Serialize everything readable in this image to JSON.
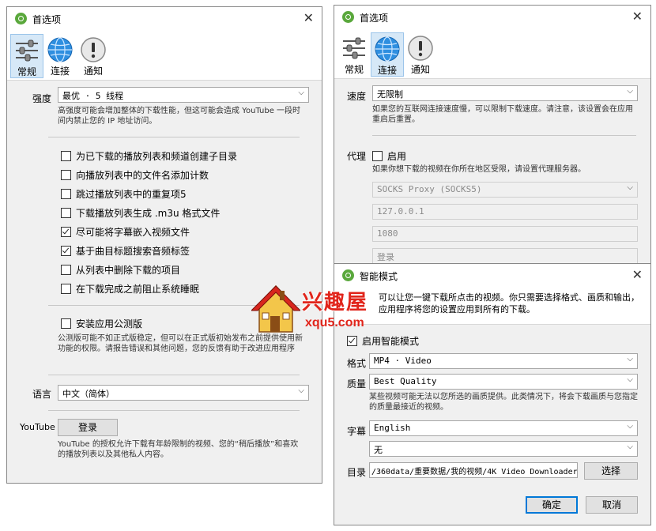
{
  "win1": {
    "title": "首选项",
    "tabs": [
      "常规",
      "连接",
      "通知"
    ],
    "strength": {
      "label": "强度",
      "value": "最优 · 5 线程",
      "desc": "高强度可能会增加整体的下载性能，但这可能会造成 YouTube 一段时间内禁止您的 IP 地址访问。"
    },
    "options": [
      {
        "label": "为已下载的播放列表和频道创建子目录",
        "checked": false
      },
      {
        "label": "向播放列表中的文件名添加计数",
        "checked": false
      },
      {
        "label": "跳过播放列表中的重复项5",
        "checked": false
      },
      {
        "label": "下载播放列表生成 .m3u 格式文件",
        "checked": false
      },
      {
        "label": "尽可能将字幕嵌入视频文件",
        "checked": true
      },
      {
        "label": "基于曲目标题搜索音频标签",
        "checked": true
      },
      {
        "label": "从列表中删除下载的项目",
        "checked": false
      },
      {
        "label": "在下载完成之前阻止系统睡眠",
        "checked": false
      }
    ],
    "beta": {
      "label": "安装应用公测版",
      "checked": false,
      "desc": "公测版可能不如正式版稳定，但可以在正式版初始发布之前提供使用新功能的权限。请报告错误和其他问题，您的反馈有助于改进应用程序"
    },
    "language": {
      "label": "语言",
      "value": "中文（简体）"
    },
    "youtube": {
      "label": "YouTube",
      "button": "登录",
      "desc": "YouTube 的授权允许下载有年龄限制的视频、您的“稍后播放”和喜欢的播放列表以及其他私人内容。"
    }
  },
  "win2": {
    "title": "首选项",
    "tabs": [
      "常规",
      "连接",
      "通知"
    ],
    "speed": {
      "label": "速度",
      "value": "无限制",
      "desc": "如果您的互联网连接速度慢，可以限制下载速度。请注意，该设置会在应用重启后重置。"
    },
    "proxy": {
      "label": "代理",
      "enable_label": "启用",
      "checked": false,
      "desc": "如果你想下载的视频在你所在地区受限，请设置代理服务器。",
      "type": "SOCKS Proxy (SOCKS5)",
      "host": "127.0.0.1",
      "port": "1080",
      "login_placeholder": "登录"
    }
  },
  "win3": {
    "title": "智能模式",
    "intro": "可以让您一键下载所点击的视频。你只需要选择格式、画质和输出，应用程序将您的设置应用到所有的下载。",
    "enable_label": "启用智能模式",
    "enable_checked": true,
    "format": {
      "label": "格式",
      "value": "MP4 · Video"
    },
    "quality": {
      "label": "质量",
      "value": "Best Quality",
      "desc": "某些视频可能无法以您所选的画质提供。此类情况下，将会下载画质与您指定的质量最接近的视频。"
    },
    "subtitle": {
      "label": "字幕",
      "value": "English",
      "value2": "无"
    },
    "directory": {
      "label": "目录",
      "value": "/360data/重要数据/我的视频/4K Video Downloader",
      "button": "选择"
    },
    "ok": "确定",
    "cancel": "取消"
  },
  "watermark": {
    "text": "兴趣屋",
    "url": "xqu5.com"
  },
  "colors": {
    "accent": "#0078d7",
    "tab_active_bg": "#d6e8f7",
    "app_icon": "#5aa83c",
    "watermark_red": "#e1251b"
  },
  "icons": [
    "app-icon",
    "sliders-icon",
    "globe-icon",
    "exclamation-icon",
    "close-icon",
    "chevron-down-icon",
    "house-logo"
  ]
}
